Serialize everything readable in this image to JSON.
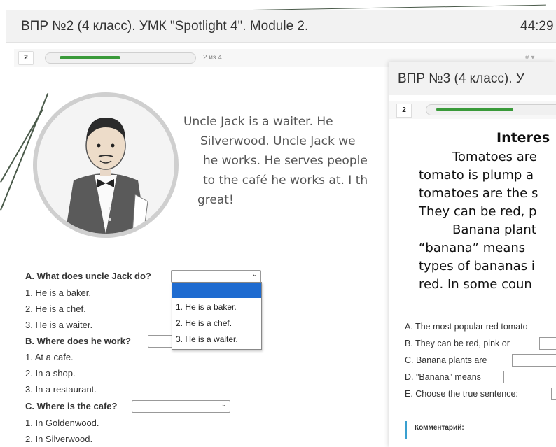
{
  "window": {
    "title": "ВПР №2 (4 класс). УМК \"Spotlight 4\". Module 2.",
    "timer": "44:29"
  },
  "nav": {
    "question_number": "2",
    "progress_text": "2 из 4",
    "progress_fraction": 0.5,
    "misc": "# ▾"
  },
  "story": {
    "lines": [
      "Uncle Jack is a waiter. He",
      "Silverwood. Uncle Jack we",
      "he works. He serves people",
      "to the café he works at. I th",
      "great!"
    ]
  },
  "questions": {
    "a_label": "A. What does uncle Jack do?",
    "a_options": [
      "1. He is a baker.",
      "2. He is a chef.",
      "3. He is a waiter."
    ],
    "b_label": "B. Where does he work?",
    "b_options": [
      "1. At a cafe.",
      "2. In a shop.",
      "3. In a restaurant."
    ],
    "c_label": "C. Where is the cafe?",
    "c_options": [
      "1. In Goldenwood.",
      "2. In Silverwood."
    ]
  },
  "dropdown": {
    "items": [
      "",
      "1. He is a baker.",
      "2. He is a chef.",
      "3. He is a waiter."
    ]
  },
  "right_panel": {
    "title": "ВПР №3 (4 класс). У",
    "question_number": "2",
    "heading": "Interes",
    "text_lines": [
      "Tomatoes are",
      "tomato is plump a",
      "tomatoes are the s",
      "They can be red, p",
      "Banana plant",
      "“banana” means",
      "types of bananas i",
      "red. In some coun"
    ],
    "questions": [
      "A. The most popular red tomato",
      "B. They can be red, pink or",
      "C. Banana plants are",
      "D. \"Banana\" means",
      "E. Choose the true sentence:"
    ],
    "comment_label": "Комментарий:"
  },
  "colors": {
    "accent_green": "#3a9a3a",
    "highlight_blue": "#1e6bd0",
    "comment_bar": "#3aa0d0"
  }
}
